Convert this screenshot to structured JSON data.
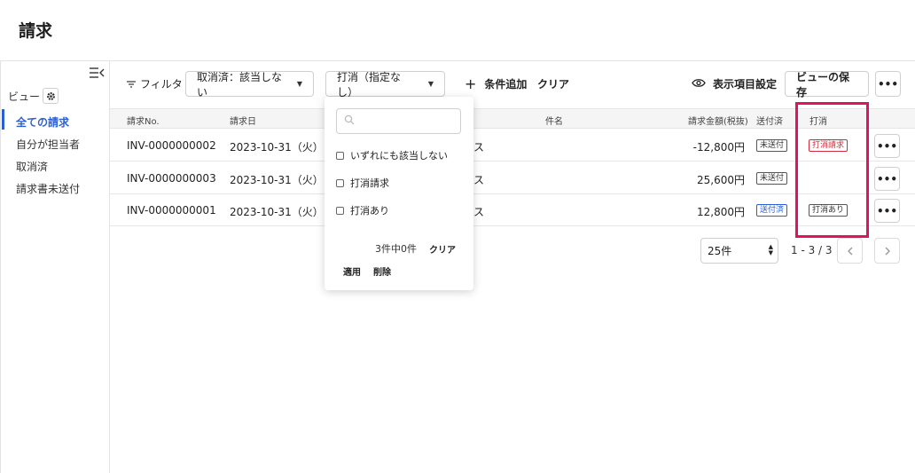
{
  "page": {
    "title": "請求"
  },
  "sidebar": {
    "view_label": "ビュー",
    "items": [
      {
        "label": "全ての請求",
        "active": true
      },
      {
        "label": "自分が担当者",
        "active": false
      },
      {
        "label": "取消済",
        "active": false
      },
      {
        "label": "請求書未送付",
        "active": false
      }
    ]
  },
  "toolbar": {
    "filter_label": "フィルタ",
    "cancelled_filter": "取消済：該当しない",
    "reversal_filter": "打消（指定なし）",
    "add_condition": "条件追加",
    "clear": "クリア",
    "display_settings": "表示項目設定",
    "save_view": "ビューの保存",
    "more": "•••"
  },
  "table": {
    "headers": {
      "invoice_no": "請求No.",
      "invoice_date": "請求日",
      "subject": "件名",
      "amount": "請求金額(税抜)",
      "sent": "送付済",
      "reversal": "打消"
    },
    "rows": [
      {
        "invoice_no": "INV-0000000002",
        "invoice_date": "2023-10-31（火）",
        "client_tail": "ス",
        "amount": "-12,800円",
        "sent": "未送付",
        "sent_status": "unsent",
        "reversal": "打消請求",
        "reversal_status": "request"
      },
      {
        "invoice_no": "INV-0000000003",
        "invoice_date": "2023-10-31（火）",
        "client_tail": "ス",
        "amount": "25,600円",
        "sent": "未送付",
        "sent_status": "unsent",
        "reversal": "",
        "reversal_status": "none"
      },
      {
        "invoice_no": "INV-0000000001",
        "invoice_date": "2023-10-31（火）",
        "client_tail": "ス",
        "amount": "12,800円",
        "sent": "送付済",
        "sent_status": "sent",
        "reversal": "打消あり",
        "reversal_status": "exists"
      }
    ]
  },
  "pagination": {
    "per_page": "25件",
    "range": "1 - 3 / 3"
  },
  "dropdown": {
    "search_placeholder": "",
    "options": [
      {
        "label": "いずれにも該当しない",
        "checked": false
      },
      {
        "label": "打消請求",
        "checked": false
      },
      {
        "label": "打消あり",
        "checked": false
      }
    ],
    "count": "3件中0件",
    "clear": "クリア",
    "apply": "適用",
    "delete": "削除"
  },
  "colors": {
    "accent": "#2b5fd6",
    "danger": "#d12c3a",
    "highlight": "#e0135f"
  },
  "icons": [
    "collapse-sidebar-icon",
    "gear-icon",
    "filter-icon",
    "caret-down-icon",
    "plus-icon",
    "eye-icon",
    "search-icon",
    "chevron-left-icon",
    "chevron-right-icon"
  ]
}
